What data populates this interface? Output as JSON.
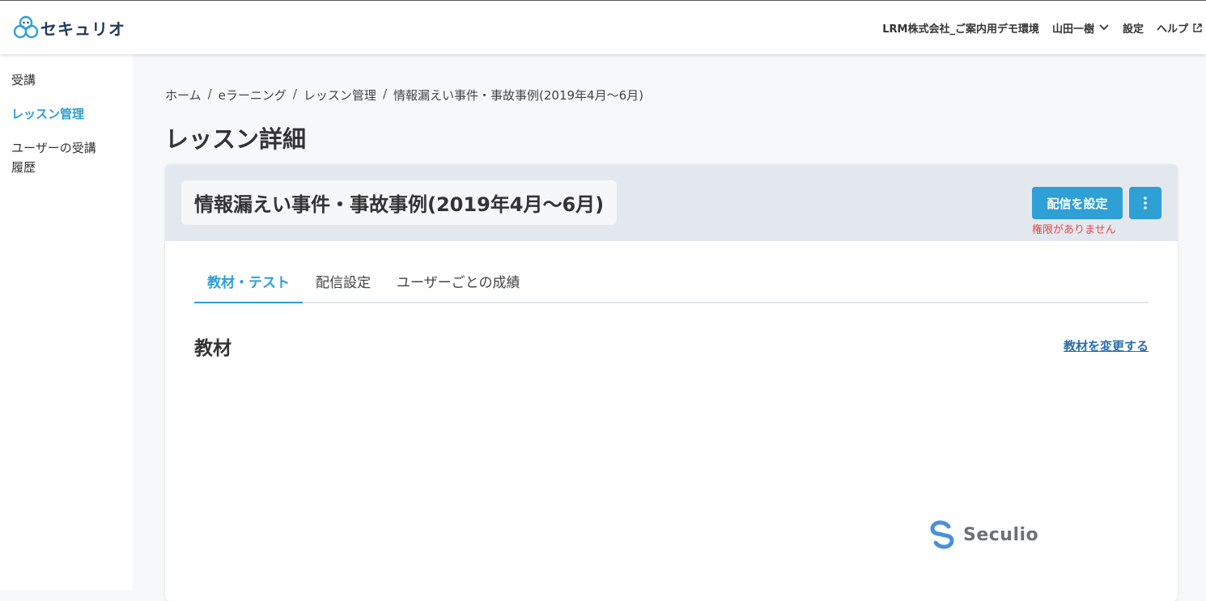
{
  "header": {
    "logo_text": "セキュリオ",
    "company": "LRM株式会社_ご案内用デモ環境",
    "user_name": "山田一樹",
    "settings": "設定",
    "help": "ヘルプ"
  },
  "sidebar": {
    "items": [
      {
        "label": "受講"
      },
      {
        "label": "レッスン管理"
      },
      {
        "label": "ユーザーの受講履歴"
      }
    ]
  },
  "breadcrumb": [
    "ホーム",
    "eラーニング",
    "レッスン管理",
    "情報漏えい事件・事故事例(2019年4月～6月)"
  ],
  "page_title": "レッスン詳細",
  "lesson": {
    "title": "情報漏えい事件・事故事例(2019年4月～6月)",
    "deliver_button": "配信を設定",
    "no_permission": "権限がありません"
  },
  "tabs": [
    {
      "label": "教材・テスト"
    },
    {
      "label": "配信設定"
    },
    {
      "label": "ユーザーごとの成績"
    }
  ],
  "material": {
    "heading": "教材",
    "change_link": "教材を変更する",
    "preview_logo_text": "Seculio"
  },
  "colors": {
    "accent": "#2ea0d6",
    "error": "#e04848",
    "link": "#2b6ea8"
  }
}
